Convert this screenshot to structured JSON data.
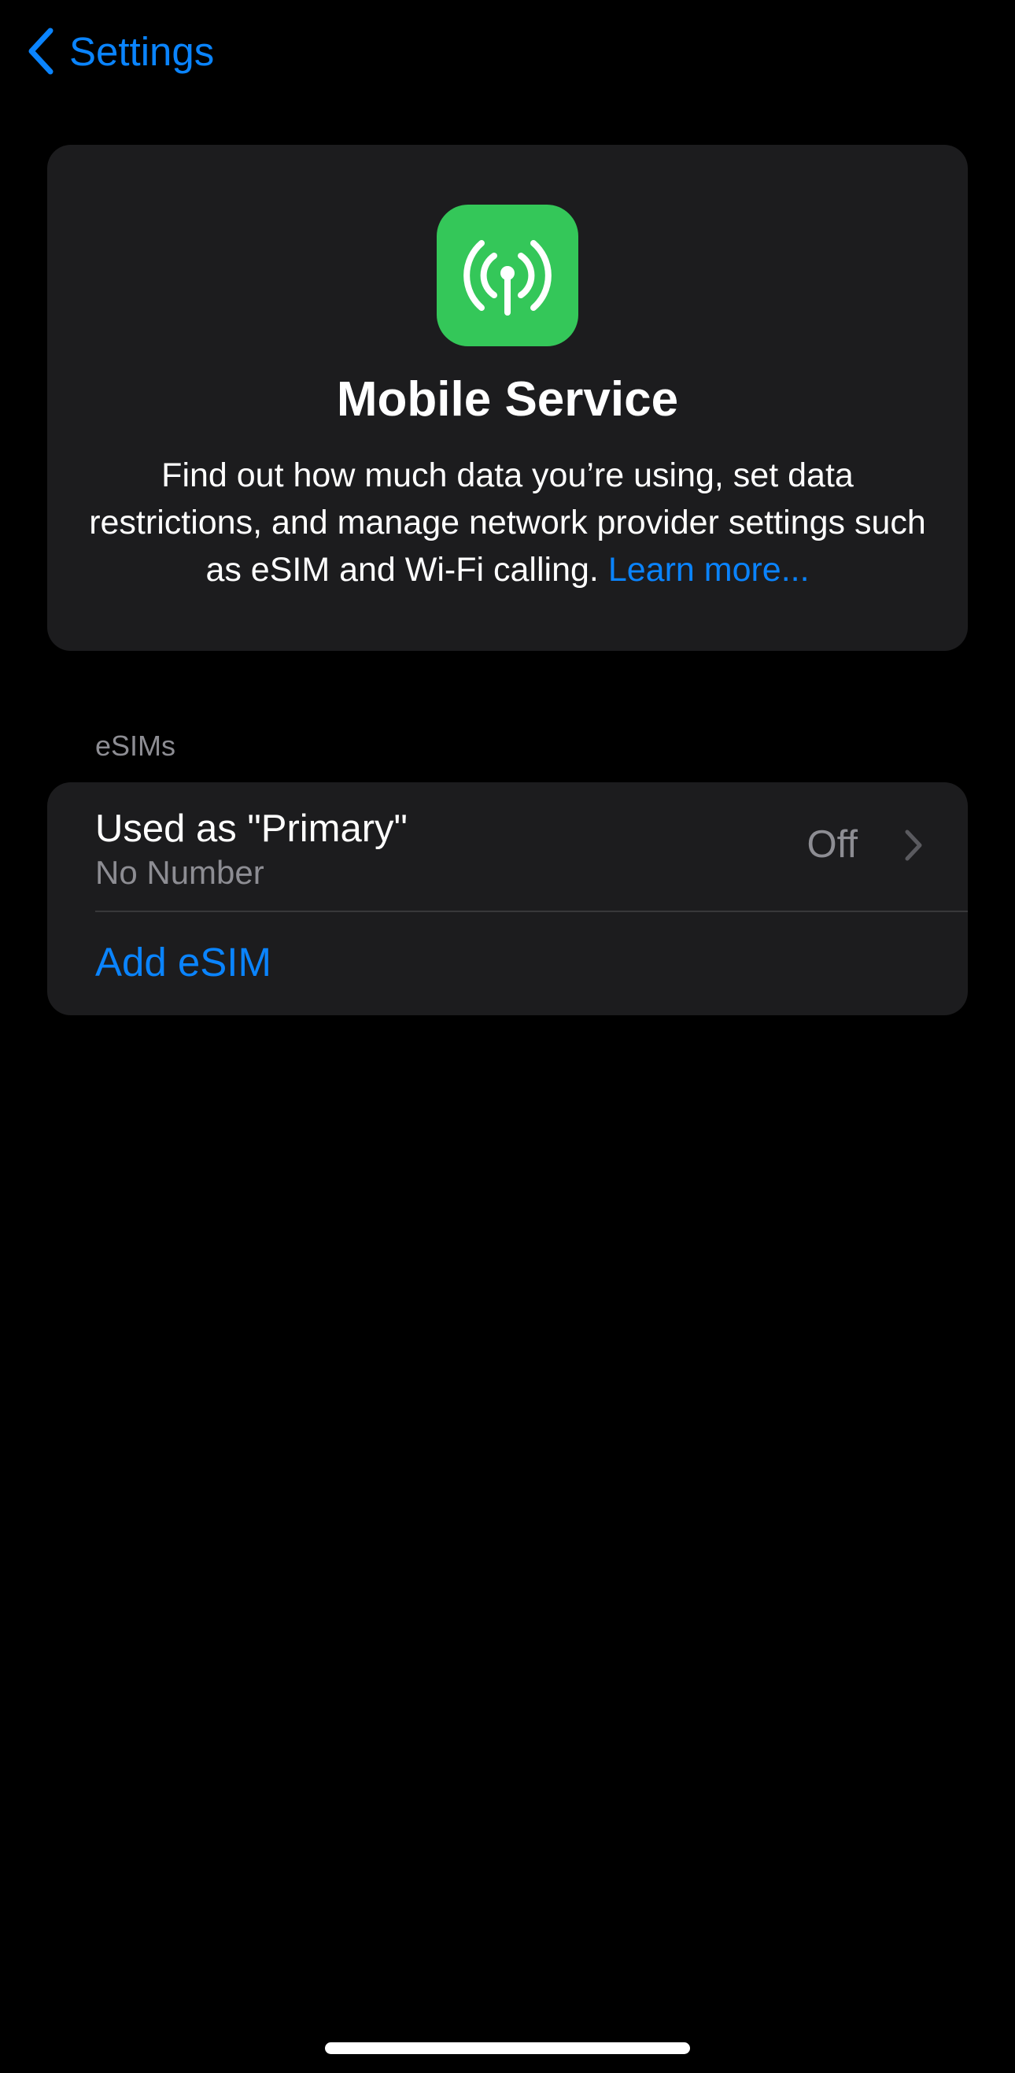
{
  "nav": {
    "back_label": "Settings",
    "back_icon": "chevron-left-icon"
  },
  "hero": {
    "icon": "antenna-radiowaves-icon",
    "icon_color": "#34C759",
    "title": "Mobile Service",
    "description": "Find out how much data you’re using, set data restrictions, and manage network provider settings such as eSIM and Wi-Fi calling.",
    "learn_more": "Learn more..."
  },
  "esims": {
    "header": "eSIMs",
    "rows": [
      {
        "title": "Used as \"Primary\"",
        "subtitle": "No Number",
        "value": "Off",
        "accessory": "chevron-right-icon"
      }
    ],
    "add_label": "Add eSIM"
  },
  "colors": {
    "background": "#000000",
    "card": "#1C1C1E",
    "accent": "#0A84FF",
    "secondary_text": "#8D8D93",
    "separator": "#38383A"
  }
}
